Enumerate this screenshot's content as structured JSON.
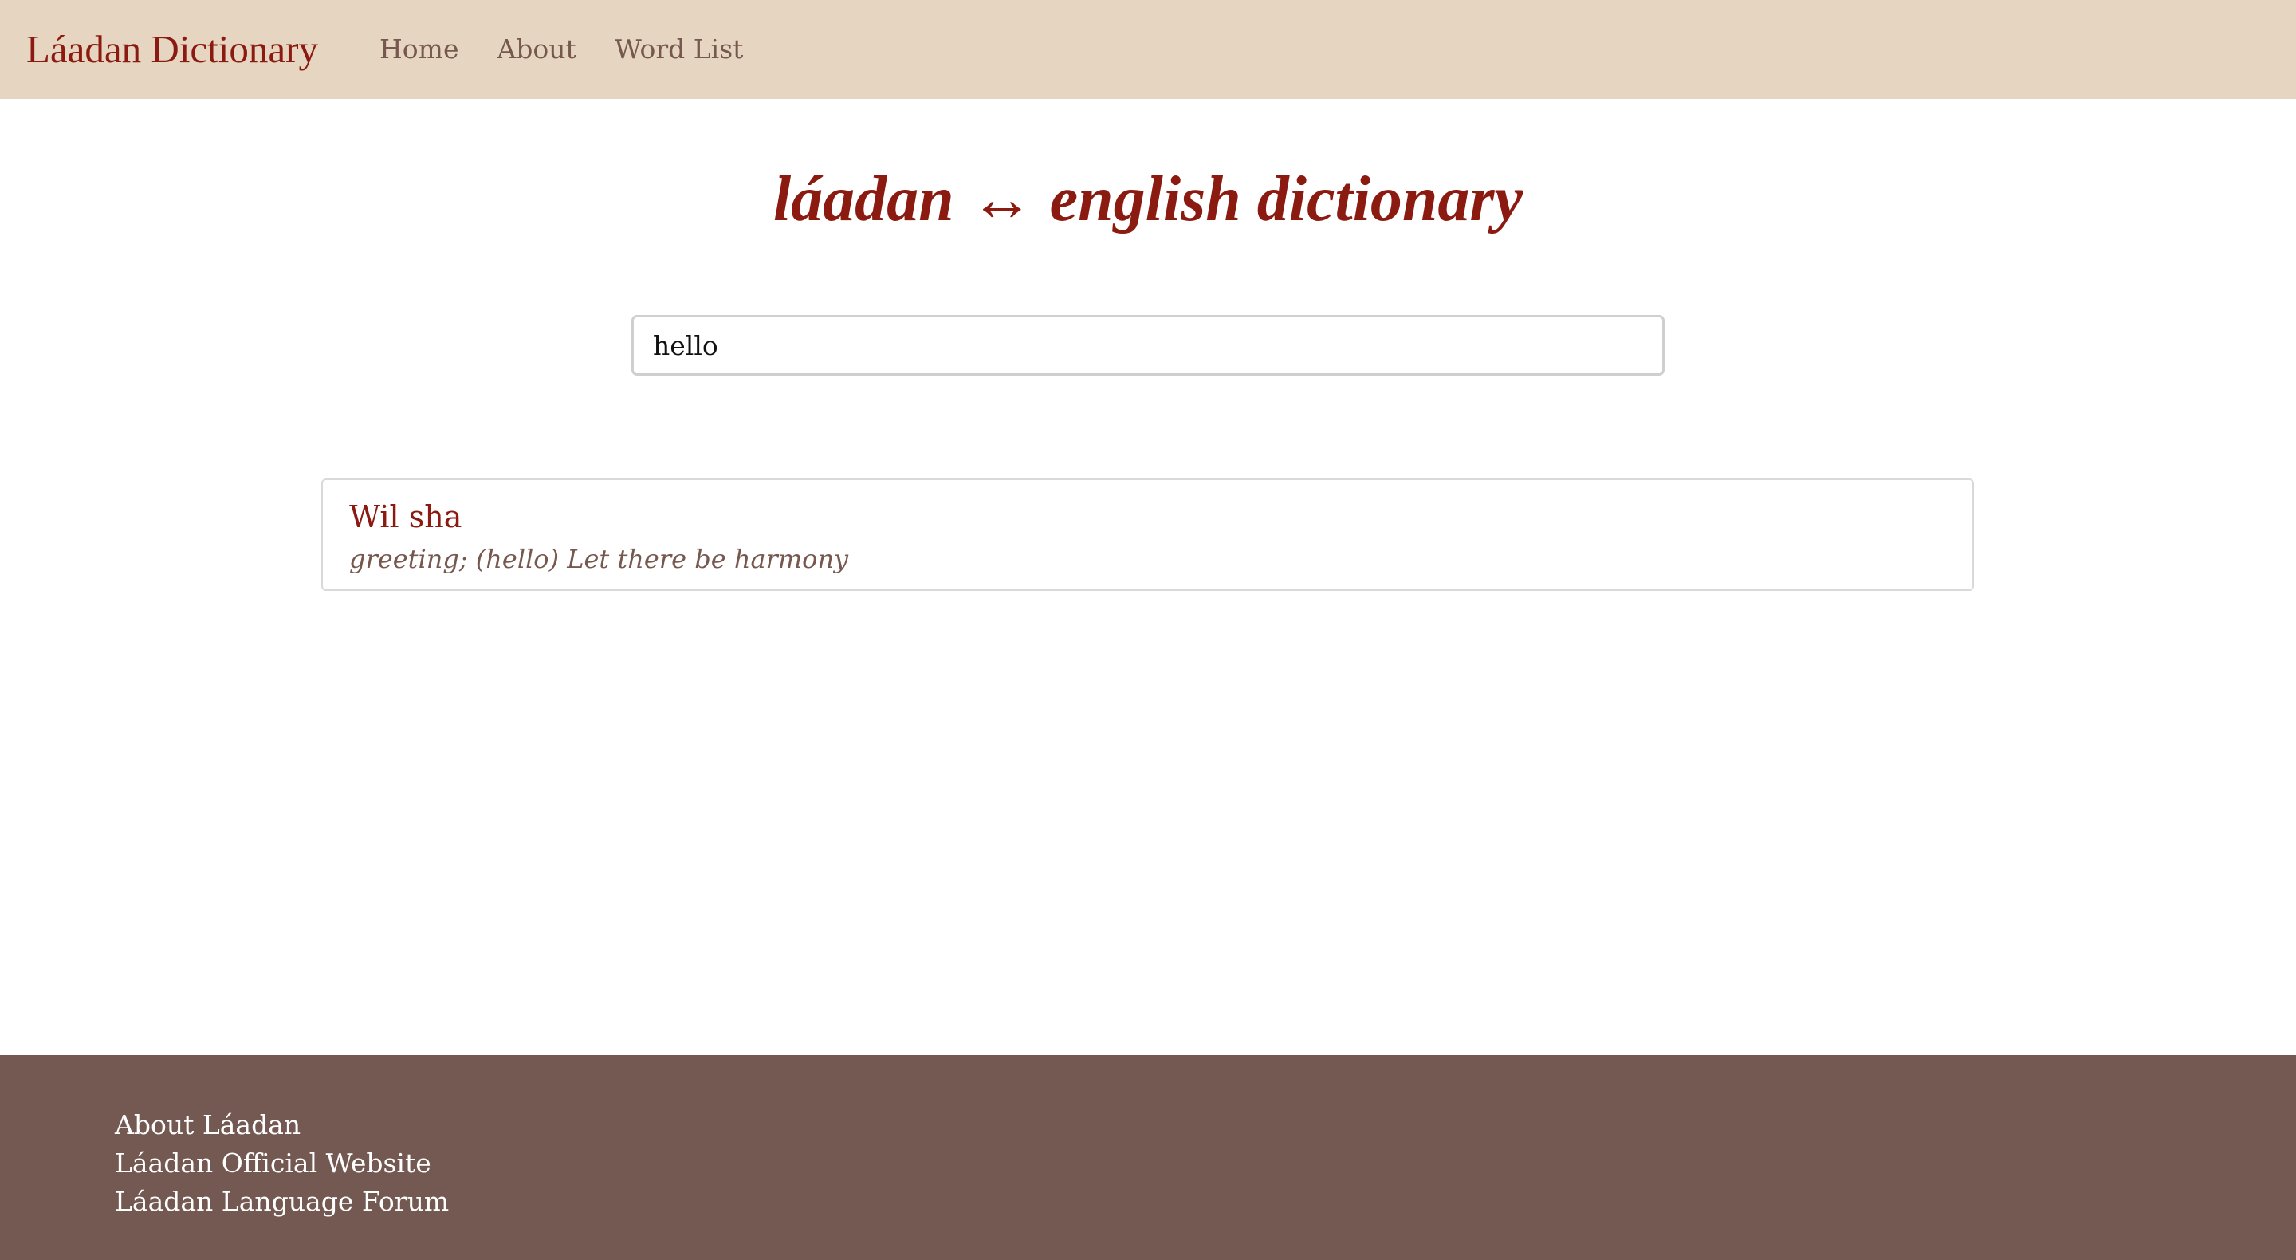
{
  "navbar": {
    "brand": "Láadan Dictionary",
    "links": [
      {
        "label": "Home"
      },
      {
        "label": "About"
      },
      {
        "label": "Word List"
      }
    ]
  },
  "main": {
    "title": "láadan ↔ english dictionary",
    "search": {
      "value": "hello",
      "placeholder": ""
    },
    "results": [
      {
        "word": "Wil sha",
        "definition": "greeting; (hello) Let there be harmony"
      }
    ]
  },
  "footer": {
    "links": [
      {
        "label": "About Láadan"
      },
      {
        "label": "Láadan Official Website"
      },
      {
        "label": "Láadan Language Forum"
      }
    ]
  },
  "colors": {
    "navbar_bg": "#e6d6c1",
    "brand": "#8b1a10",
    "nav_link": "#76584f",
    "footer_bg": "#745952",
    "footer_text": "#ffffff"
  }
}
